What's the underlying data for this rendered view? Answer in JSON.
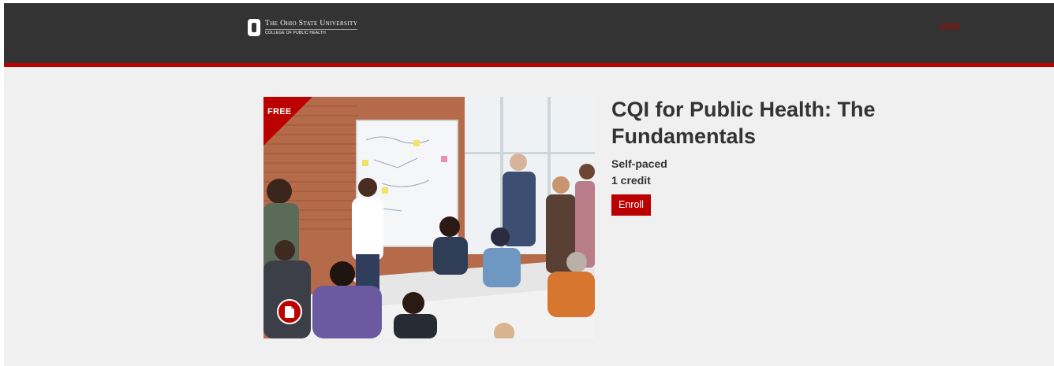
{
  "header": {
    "logo_line1": "The Ohio State University",
    "logo_line2": "COLLEGE OF PUBLIC HEALTH",
    "login_label": "Login"
  },
  "course": {
    "badge": "FREE",
    "title": "CQI for Public Health: The Fundamentals",
    "pace": "Self-paced",
    "credits": "1 credit",
    "enroll_label": "Enroll",
    "type_icon": "document-icon"
  },
  "colors": {
    "brand_red": "#bb0000",
    "header_bg": "#333333",
    "page_bg": "#f0f0f0"
  }
}
